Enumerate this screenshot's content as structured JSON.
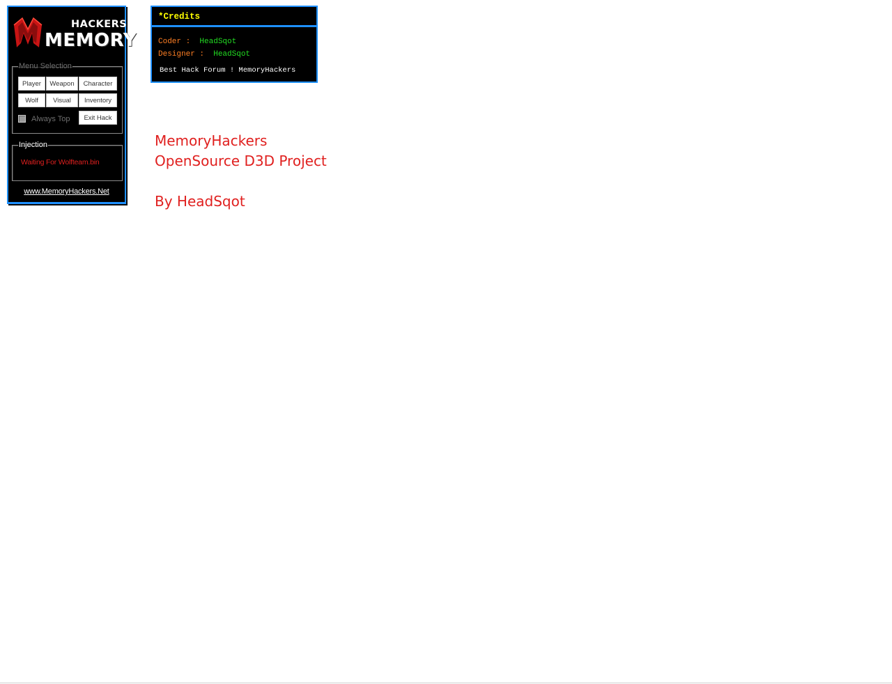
{
  "logo": {
    "top_word": "HACKERS",
    "main_word": "MEMORY",
    "accent_color": "#e0201f"
  },
  "menu_selection": {
    "legend": "Menu Selection",
    "buttons": [
      "Player",
      "Weapon",
      "Character",
      "Wolf",
      "Visual",
      "Inventory"
    ],
    "exit_label": "Exit Hack",
    "always_top_label": "Always Top",
    "always_top_checked": false
  },
  "injection": {
    "legend": "Injection",
    "status": "Waiting For Wolfteam.bin"
  },
  "site_link": "www.MemoryHackers.Net",
  "credits": {
    "title": "*Credits",
    "coder_label": "Coder :",
    "coder_value": "HeadSqot",
    "designer_label": "Designer :",
    "designer_value": "HeadSqot",
    "forum_line": "Best Hack Forum ! MemoryHackers"
  },
  "headline": {
    "line1": "MemoryHackers",
    "line2": "OpenSource D3D Project",
    "line3": "",
    "line4": "By HeadSqot"
  },
  "colors": {
    "panel_border": "#1e90ff",
    "panel_bg": "#000000",
    "title_yellow": "#ffff00",
    "label_orange": "#ff7f24",
    "value_green": "#22dd22",
    "text_red": "#e0201f"
  }
}
